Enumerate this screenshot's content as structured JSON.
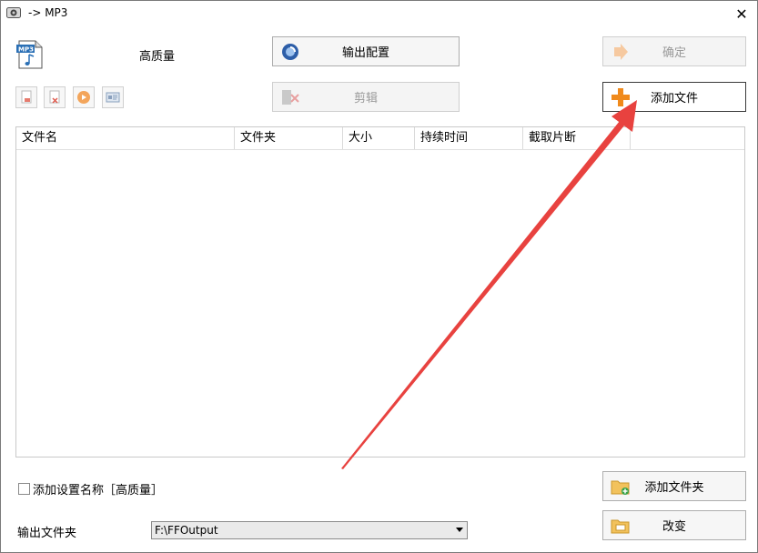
{
  "window": {
    "title": "-> MP3"
  },
  "header": {
    "quality": "高质量"
  },
  "buttons": {
    "output_config": "输出配置",
    "ok": "确定",
    "clip": "剪辑",
    "add_file": "添加文件",
    "add_folder": "添加文件夹",
    "change": "改变"
  },
  "table": {
    "columns": [
      "文件名",
      "文件夹",
      "大小",
      "持续时间",
      "截取片断"
    ]
  },
  "options": {
    "add_setting_name": "添加设置名称［高质量］"
  },
  "output": {
    "label": "输出文件夹",
    "path": "F:\\FFOutput"
  },
  "colors": {
    "annotation_arrow": "#e8423f",
    "accent_orange": "#f08a1c"
  },
  "icons": [
    "mp3-file-icon",
    "output-config-icon",
    "ok-arrow-icon",
    "clip-scissors-icon",
    "add-plus-icon",
    "add-folder-icon",
    "change-folder-icon"
  ]
}
